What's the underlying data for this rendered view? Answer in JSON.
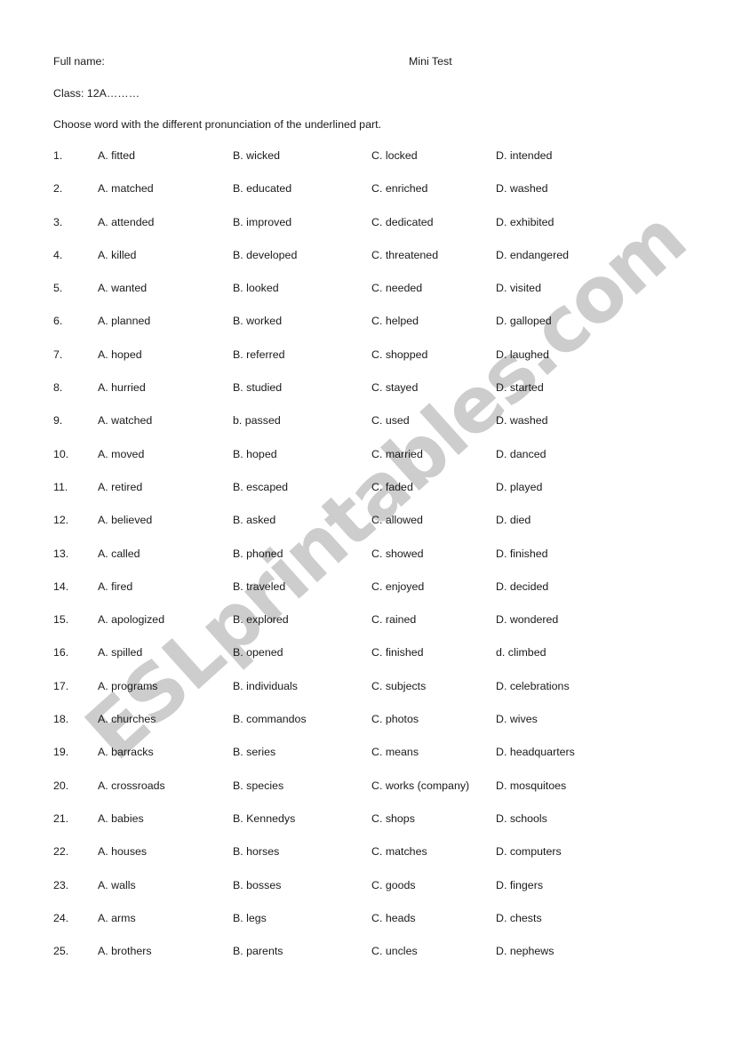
{
  "header": {
    "full_name_label": "Full name:",
    "title": "Mini Test",
    "class_label": "Class: 12A………",
    "instruction": "Choose word with the different pronunciation of the underlined part."
  },
  "watermark": {
    "text": "ESLprintables.com",
    "color": "#c9c9c9"
  },
  "questions": [
    {
      "num": "1.",
      "a": "A. fitted",
      "b": "B. wicked",
      "c": "C. locked",
      "d": "D. intended"
    },
    {
      "num": "2.",
      "a": "A. matched",
      "b": "B. educated",
      "c": "C. enriched",
      "d": "D. washed"
    },
    {
      "num": "3.",
      "a": "A. attended",
      "b": "B. improved",
      "c": "C. dedicated",
      "d": "D. exhibited"
    },
    {
      "num": "4.",
      "a": "A. killed",
      "b": "B. developed",
      "c": "C. threatened",
      "d": "D. endangered"
    },
    {
      "num": "5.",
      "a": "A. wanted",
      "b": "B. looked",
      "c": "C. needed",
      "d": "D. visited"
    },
    {
      "num": "6.",
      "a": "A. planned",
      "b": "B. worked",
      "c": "C. helped",
      "d": "D. galloped"
    },
    {
      "num": "7.",
      "a": "A. hoped",
      "b": "B. referred",
      "c": "C. shopped",
      "d": "D. laughed"
    },
    {
      "num": "8.",
      "a": "A. hurried",
      "b": "B. studied",
      "c": "C. stayed",
      "d": "D. started"
    },
    {
      "num": "9.",
      "a": "A. watched",
      "b": "b. passed",
      "c": "C. used",
      "d": "D. washed"
    },
    {
      "num": "10.",
      "a": "A. moved",
      "b": "B. hoped",
      "c": "C. married",
      "d": "D. danced"
    },
    {
      "num": "11.",
      "a": "A. retired",
      "b": "B. escaped",
      "c": "C. faded",
      "d": "D. played"
    },
    {
      "num": "12.",
      "a": "A. believed",
      "b": "B. asked",
      "c": "C. allowed",
      "d": "D. died"
    },
    {
      "num": "13.",
      "a": "A. called",
      "b": "B. phoned",
      "c": "C. showed",
      "d": "D. finished"
    },
    {
      "num": "14.",
      "a": "A. fired",
      "b": "B. traveled",
      "c": "C. enjoyed",
      "d": "D. decided"
    },
    {
      "num": "15.",
      "a": "A. apologized",
      "b": "B. explored",
      "c": "C. rained",
      "d": "D. wondered"
    },
    {
      "num": "16.",
      "a": "A. spilled",
      "b": "B. opened",
      "c": "C. finished",
      "d": "d. climbed"
    },
    {
      "num": "17.",
      "a": "A. programs",
      "b": "B. individuals",
      "c": "C. subjects",
      "d": "D. celebrations"
    },
    {
      "num": "18.",
      "a": "A. churches",
      "b": "B. commandos",
      "c": "C. photos",
      "d": "D. wives"
    },
    {
      "num": "19.",
      "a": "A. barracks",
      "b": "B. series",
      "c": "C. means",
      "d": "D. headquarters"
    },
    {
      "num": "20.",
      "a": "A. crossroads",
      "b": "B. species",
      "c": "C. works (company)",
      "d": "D. mosquitoes"
    },
    {
      "num": "21.",
      "a": "A. babies",
      "b": "B. Kennedys",
      "c": "C. shops",
      "d": "D. schools"
    },
    {
      "num": "22.",
      "a": "A. houses",
      "b": "B. horses",
      "c": "C. matches",
      "d": "D. computers"
    },
    {
      "num": "23.",
      "a": "A. walls",
      "b": "B. bosses",
      "c": "C. goods",
      "d": "D. fingers"
    },
    {
      "num": "24.",
      "a": "A. arms",
      "b": "B. legs",
      "c": "C. heads",
      "d": "D. chests"
    },
    {
      "num": "25.",
      "a": "A. brothers",
      "b": "B. parents",
      "c": "C. uncles",
      "d": "D. nephews"
    }
  ]
}
